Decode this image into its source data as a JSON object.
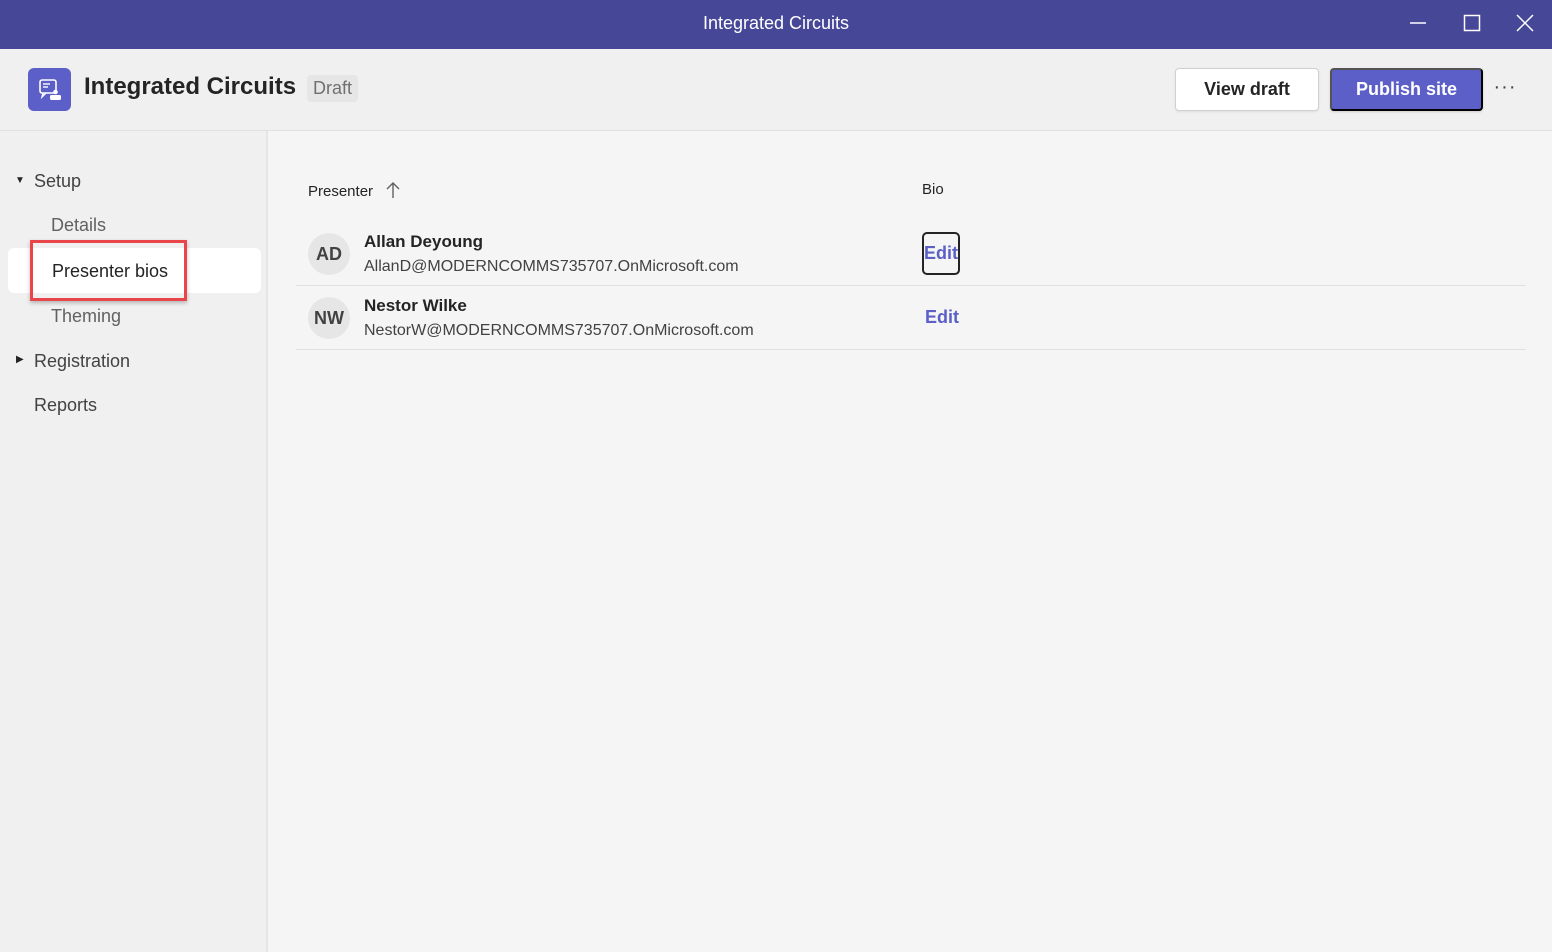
{
  "window": {
    "title": "Integrated Circuits",
    "controls": [
      "minimize",
      "maximize",
      "close"
    ]
  },
  "header": {
    "app_icon": "presenter-bio-icon",
    "title": "Integrated Circuits",
    "badge": "Draft",
    "view_draft_label": "View draft",
    "publish_label": "Publish site",
    "more_label": "···"
  },
  "sidebar": {
    "setup": {
      "label": "Setup",
      "expanded": true
    },
    "setup_items": [
      {
        "label": "Details"
      },
      {
        "label": "Presenter bios",
        "selected": true
      },
      {
        "label": "Theming"
      }
    ],
    "registration": {
      "label": "Registration",
      "expanded": false
    },
    "reports": {
      "label": "Reports"
    }
  },
  "table": {
    "columns": [
      {
        "label": "Presenter",
        "sort": "ascending"
      },
      {
        "label": "Bio"
      }
    ],
    "rows": [
      {
        "initials": "AD",
        "name": "Allan Deyoung",
        "email": "AllanD@MODERNCOMMS735707.OnMicrosoft.com",
        "action": "Edit"
      },
      {
        "initials": "NW",
        "name": "Nestor Wilke",
        "email": "NestorW@MODERNCOMMS735707.OnMicrosoft.com",
        "action": "Edit"
      }
    ]
  },
  "colors": {
    "titlebar": "#464897",
    "accent": "#5b5fc7",
    "highlight": "#e8464b"
  }
}
